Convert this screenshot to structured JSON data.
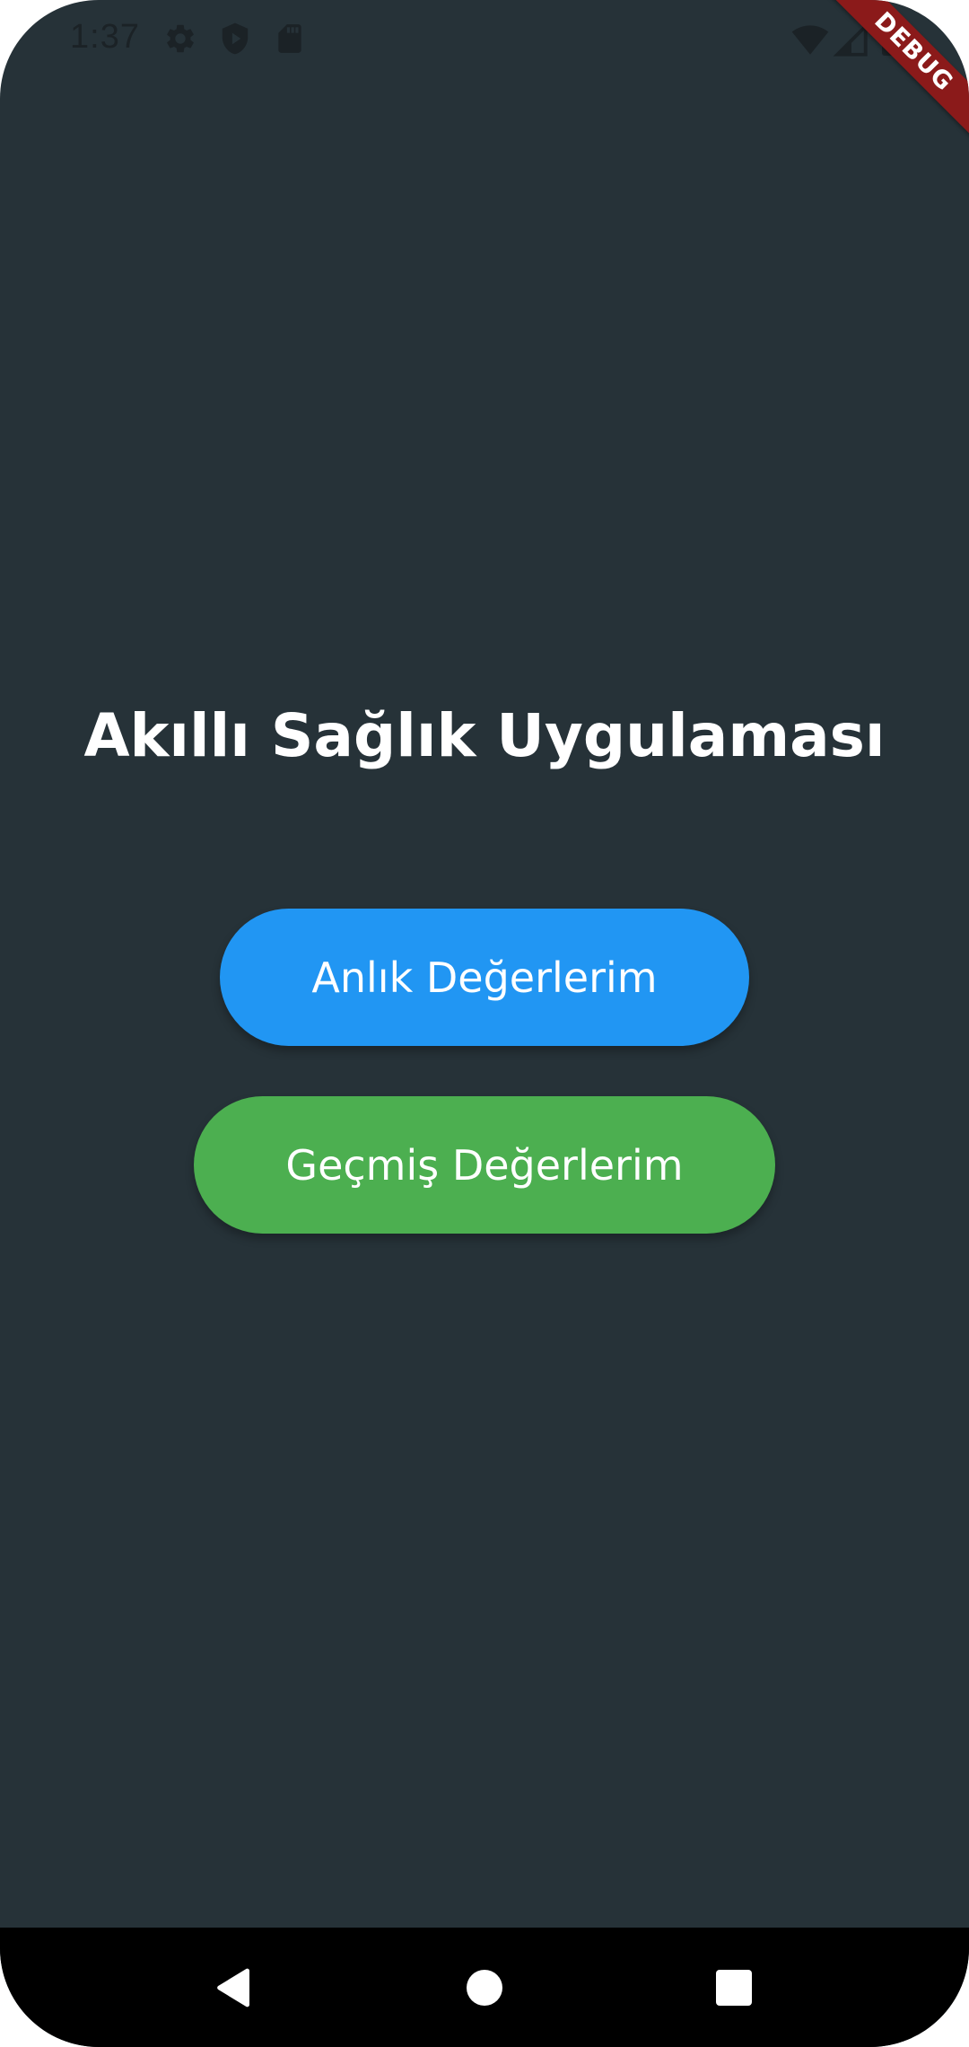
{
  "status_bar": {
    "time": "1:37",
    "left_icons": [
      "gear-icon",
      "shield-icon",
      "sd-card-icon"
    ],
    "right_icons": [
      "wifi-icon",
      "signal-icon",
      "battery-icon"
    ]
  },
  "debug_banner": {
    "label": "DEBUG",
    "color": "#8b1a1a"
  },
  "main": {
    "title": "Akıllı Sağlık Uygulaması",
    "buttons": {
      "current_values_label": "Anlık Değerlerim",
      "current_values_color": "#2196f3",
      "history_values_label": "Geçmiş Değerlerim",
      "history_values_color": "#4caf50"
    }
  },
  "nav_bar": {
    "items": [
      "back-icon",
      "home-icon",
      "recents-icon"
    ]
  },
  "colors": {
    "background": "#263238",
    "title_text": "#ffffff",
    "nav_bar": "#000000"
  }
}
